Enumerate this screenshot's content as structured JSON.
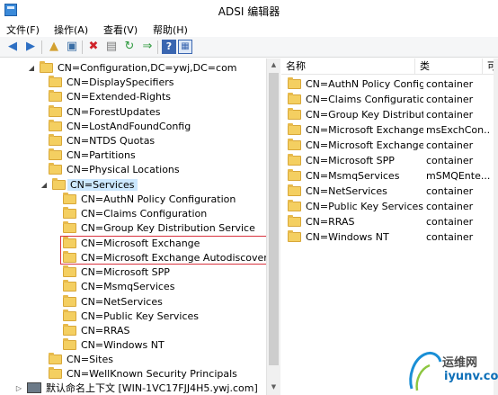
{
  "window": {
    "title": "ADSI 编辑器"
  },
  "menu": [
    "文件(F)",
    "操作(A)",
    "查看(V)",
    "帮助(H)"
  ],
  "toolbar": [
    "back-icon",
    "forward-icon",
    "up-folder-icon",
    "show-tree-icon",
    "delete-icon",
    "properties-icon",
    "refresh-icon",
    "export-icon",
    "help-icon",
    "window-icon"
  ],
  "tree": {
    "root": "CN=Configuration,DC=ywj,DC=com",
    "level1_a": [
      "CN=DisplaySpecifiers",
      "CN=Extended-Rights",
      "CN=ForestUpdates",
      "CN=LostAndFoundConfig",
      "CN=NTDS Quotas",
      "CN=Partitions",
      "CN=Physical Locations"
    ],
    "services": "CN=Services",
    "services_children": [
      "CN=AuthN Policy Configuration",
      "CN=Claims Configuration",
      "CN=Group Key Distribution Service",
      "CN=Microsoft Exchange",
      "CN=Microsoft Exchange Autodiscover",
      "CN=Microsoft SPP",
      "CN=MsmqServices",
      "CN=NetServices",
      "CN=Public Key Services",
      "CN=RRAS",
      "CN=Windows NT"
    ],
    "level1_b": [
      "CN=Sites",
      "CN=WellKnown Security Principals"
    ],
    "default_context": "默认命名上下文 [WIN-1VC17FJJ4H5.ywj.com]"
  },
  "list": {
    "columns": [
      "名称",
      "类",
      "可"
    ],
    "rows": [
      {
        "name": "CN=AuthN Policy Config...",
        "type": "container"
      },
      {
        "name": "CN=Claims Configuration",
        "type": "container"
      },
      {
        "name": "CN=Group Key Distributi...",
        "type": "container"
      },
      {
        "name": "CN=Microsoft Exchange",
        "type": "msExchCon..."
      },
      {
        "name": "CN=Microsoft Exchange ...",
        "type": "container"
      },
      {
        "name": "CN=Microsoft SPP",
        "type": "container"
      },
      {
        "name": "CN=MsmqServices",
        "type": "mSMQEnte..."
      },
      {
        "name": "CN=NetServices",
        "type": "container"
      },
      {
        "name": "CN=Public Key Services",
        "type": "container"
      },
      {
        "name": "CN=RRAS",
        "type": "container"
      },
      {
        "name": "CN=Windows NT",
        "type": "container"
      }
    ]
  },
  "watermark": {
    "text": "运维网",
    "url": "iyunv.com"
  },
  "colors": {
    "selection": "#cce8ff",
    "highlight_box": "#d9333f",
    "folder": "#f4cf61"
  }
}
